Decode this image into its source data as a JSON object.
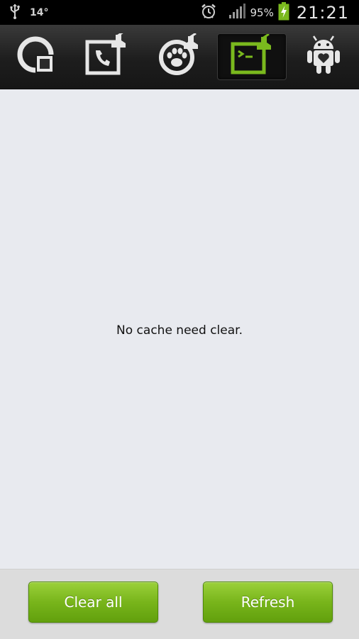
{
  "status_bar": {
    "temperature": "14°",
    "battery_percent": "95%",
    "time": "21:21",
    "icons": [
      "usb-icon",
      "alarm-icon",
      "signal-icon",
      "battery-charging-icon"
    ]
  },
  "tabs": [
    {
      "name": "disk-usage-icon",
      "active": false
    },
    {
      "name": "call-log-cleaner-icon",
      "active": false
    },
    {
      "name": "history-cleaner-icon",
      "active": false
    },
    {
      "name": "cache-cleaner-icon",
      "active": true
    },
    {
      "name": "android-app-icon",
      "active": false
    }
  ],
  "colors": {
    "accent_green": "#7ab91e",
    "tab_icon_gray": "#e6e6e6",
    "background": "#e8eaef"
  },
  "content": {
    "empty_message": "No cache need clear."
  },
  "buttons": {
    "clear_all": "Clear all",
    "refresh": "Refresh"
  }
}
